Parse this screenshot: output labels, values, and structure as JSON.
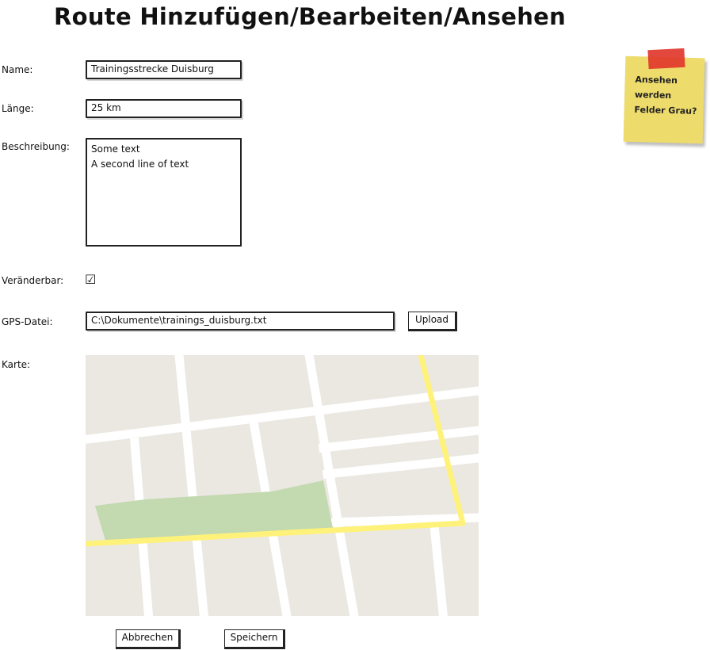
{
  "page": {
    "title": "Route Hinzufügen/Bearbeiten/Ansehen"
  },
  "form": {
    "name_label": "Name:",
    "name_value": "Trainingsstrecke Duisburg",
    "length_label": "Länge:",
    "length_value": "25 km",
    "description_label": "Beschreibung:",
    "description_lines": [
      "Some text",
      "A second line of text"
    ],
    "editable_label": "Veränderbar:",
    "editable_checked": true,
    "gps_label": "GPS-Datei:",
    "gps_value": "C:\\Dokumente\\trainings_duisburg.txt",
    "upload_label": "Upload",
    "map_label": "Karte:"
  },
  "actions": {
    "cancel_label": "Abbrechen",
    "save_label": "Speichern"
  },
  "sticky_note": {
    "text": "Ansehen\nwerden\nFelder Grau?"
  },
  "map": {
    "background_color": "#ebe8e2",
    "street_color": "#ffffff",
    "route_color": "#fff27a",
    "park_color": "#c3d9b0"
  }
}
